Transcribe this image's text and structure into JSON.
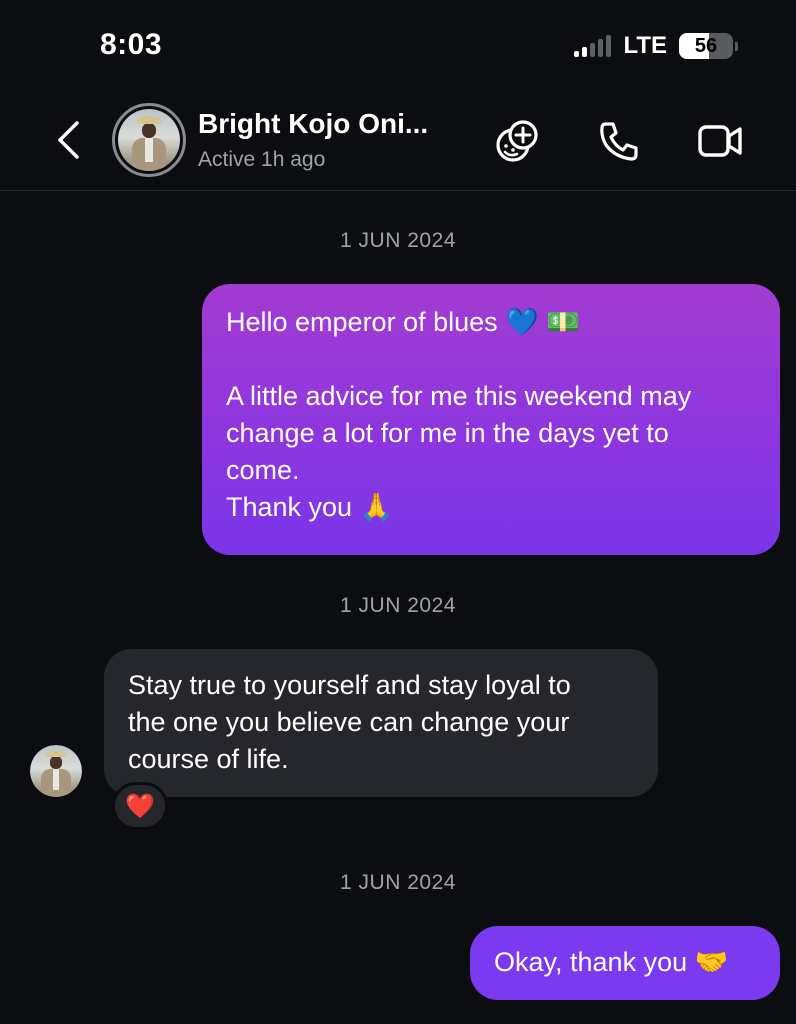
{
  "status_bar": {
    "time": "8:03",
    "network": "LTE",
    "battery": "56",
    "battery_level": 0.56
  },
  "header": {
    "contact_name": "Bright Kojo Oni...",
    "contact_status": "Active 1h ago",
    "icons": [
      "back-icon",
      "effects-icon",
      "phone-icon",
      "video-camera-icon"
    ]
  },
  "messages": [
    {
      "date": "1 JUN 2024",
      "direction": "outgoing",
      "lines": [
        "Hello emperor of blues 💙 💵",
        "",
        "A little advice for me this weekend may",
        "change a lot for me in the days yet to",
        "come.",
        "Thank you 🙏"
      ]
    },
    {
      "date": "1 JUN 2024",
      "direction": "incoming",
      "lines": [
        "Stay true to yourself and stay loyal to",
        "the one  you believe can change your",
        "course of life."
      ],
      "reaction": "❤️"
    },
    {
      "date": "1 JUN 2024",
      "direction": "outgoing",
      "lines": [
        "Okay, thank you 🤝"
      ]
    }
  ],
  "colors": {
    "background": "#0c0d11",
    "outgoing_bubble": "#8b36e0",
    "incoming_bubble": "#26272c",
    "muted_text": "#a1a2a8"
  }
}
